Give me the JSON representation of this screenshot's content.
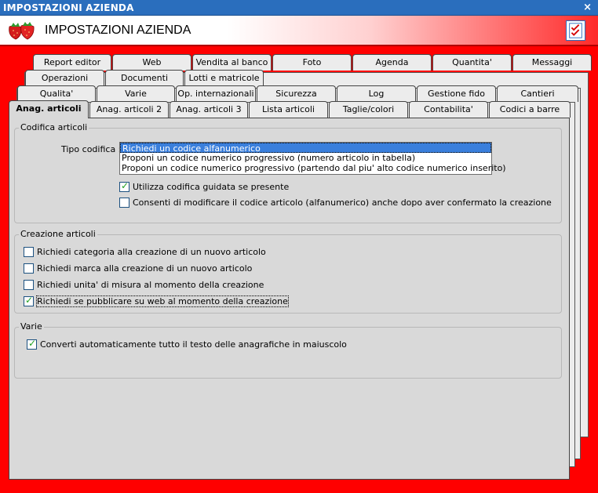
{
  "window": {
    "title": "IMPOSTAZIONI AZIENDA",
    "close_glyph": "×"
  },
  "header": {
    "title": "IMPOSTAZIONI AZIENDA",
    "logo_icon": "strawberry-icon",
    "check_icon": "checklist-icon"
  },
  "tabs": {
    "row1": [
      "Report editor",
      "Web",
      "Vendita al banco",
      "Foto",
      "Agenda",
      "Quantita'",
      "Messaggi"
    ],
    "row2": [
      "Operazioni",
      "Documenti",
      "Lotti e matricole"
    ],
    "row3": [
      "Qualita'",
      "Varie",
      "Op. internazionali",
      "Sicurezza",
      "Log",
      "Gestione fido",
      "Cantieri"
    ],
    "row4": [
      "Anag. articoli",
      "Anag. articoli 2",
      "Anag. articoli 3",
      "Lista articoli",
      "Taglie/colori",
      "Contabilita'",
      "Codici a barre"
    ],
    "active": "Anag. articoli"
  },
  "codifica": {
    "title": "Codifica articoli",
    "tipo_label": "Tipo codifica :",
    "options": [
      "Richiedi un codice alfanumerico",
      "Proponi un codice numerico progressivo (numero articolo in tabella)",
      "Proponi un codice numerico progressivo (partendo dal piu' alto codice numerico inserito)"
    ],
    "selected_index": 0,
    "checkboxes": [
      {
        "label": "Utilizza codifica guidata se presente",
        "checked": true
      },
      {
        "label": "Consenti di modificare il codice articolo (alfanumerico) anche dopo aver confermato la creazione",
        "checked": false
      }
    ]
  },
  "creazione": {
    "title": "Creazione articoli",
    "checkboxes": [
      {
        "label": "Richiedi categoria alla creazione di un nuovo articolo",
        "checked": false
      },
      {
        "label": "Richiedi marca alla creazione di un nuovo articolo",
        "checked": false
      },
      {
        "label": "Richiedi unita' di misura al momento della creazione",
        "checked": false
      },
      {
        "label": "Richiedi se pubblicare su web al momento della creazione",
        "checked": true
      }
    ]
  },
  "varie": {
    "title": "Varie",
    "checkboxes": [
      {
        "label": "Converti automaticamente tutto il testo delle anagrafiche in maiuscolo",
        "checked": true
      }
    ]
  },
  "colors": {
    "title_bar": "#2a6ebd",
    "accent_red": "#ff0000",
    "panel": "#d9d9d9",
    "selection": "#3a7fdc",
    "check": "#21a121"
  }
}
